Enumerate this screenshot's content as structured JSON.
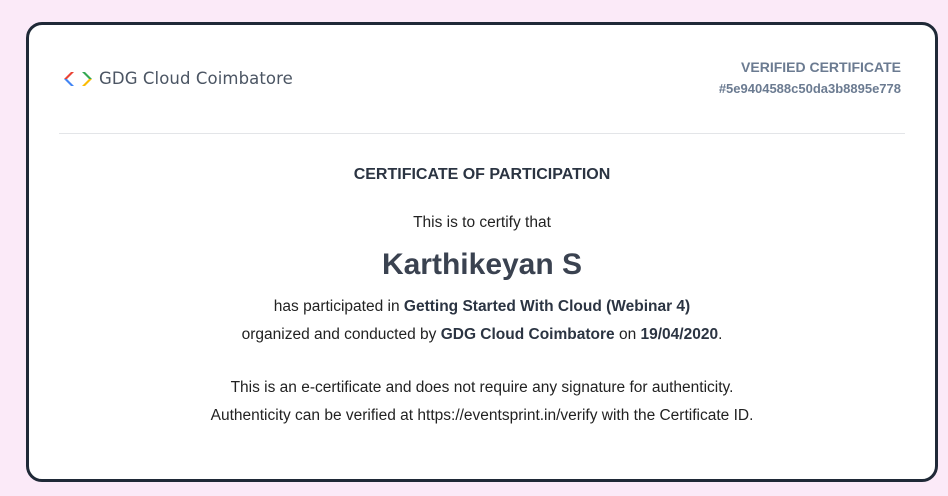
{
  "header": {
    "organizer_name": "GDG Cloud Coimbatore",
    "logo_icon": "gdg-chevrons-icon",
    "verified_label": "VERIFIED CERTIFICATE",
    "certificate_id": "#5e9404588c50da3b8895e778"
  },
  "body": {
    "certificate_type": "CERTIFICATE OF PARTICIPATION",
    "certify_text": "This is to certify that",
    "recipient_name": "Karthikeyan S",
    "participation_prefix": "has participated in ",
    "event_name": "Getting Started With Cloud (Webinar 4)",
    "organized_prefix": "organized and conducted by ",
    "organizer_name": "GDG Cloud Coimbatore",
    "date_prefix": " on ",
    "event_date": "19/04/2020",
    "date_suffix": "."
  },
  "footer": {
    "note_line1": "This is an e-certificate and does not require any signature for authenticity.",
    "note_line2": "Authenticity can be verified at https://eventsprint.in/verify with the Certificate ID."
  },
  "colors": {
    "background": "#fbeaf8",
    "border": "#1f2937",
    "verified_text": "#6b7b91",
    "logo_red": "#ea4335",
    "logo_blue": "#4285f4",
    "logo_yellow": "#fbbc04",
    "logo_green": "#34a853"
  }
}
